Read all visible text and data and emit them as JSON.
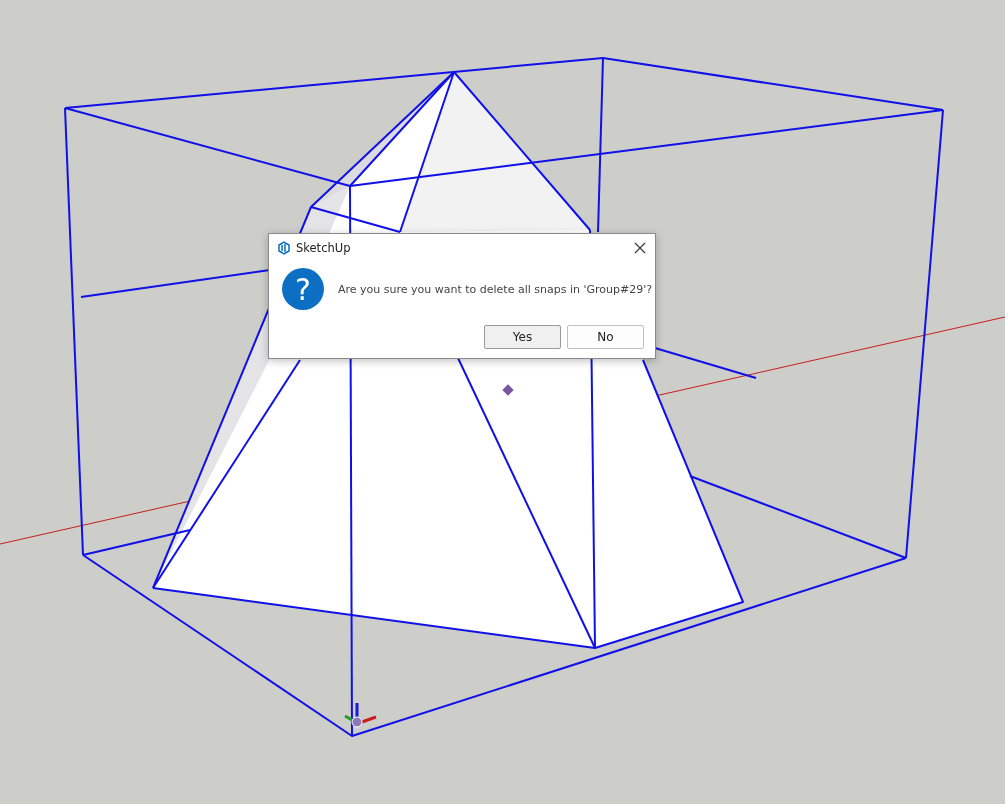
{
  "dialog": {
    "title": "SketchUp",
    "icon_glyph": "?",
    "message": "Are you sure you want to delete all snaps in 'Group#29'?",
    "buttons": [
      {
        "label": "Yes",
        "selected": true
      },
      {
        "label": "No",
        "selected": false
      }
    ]
  }
}
